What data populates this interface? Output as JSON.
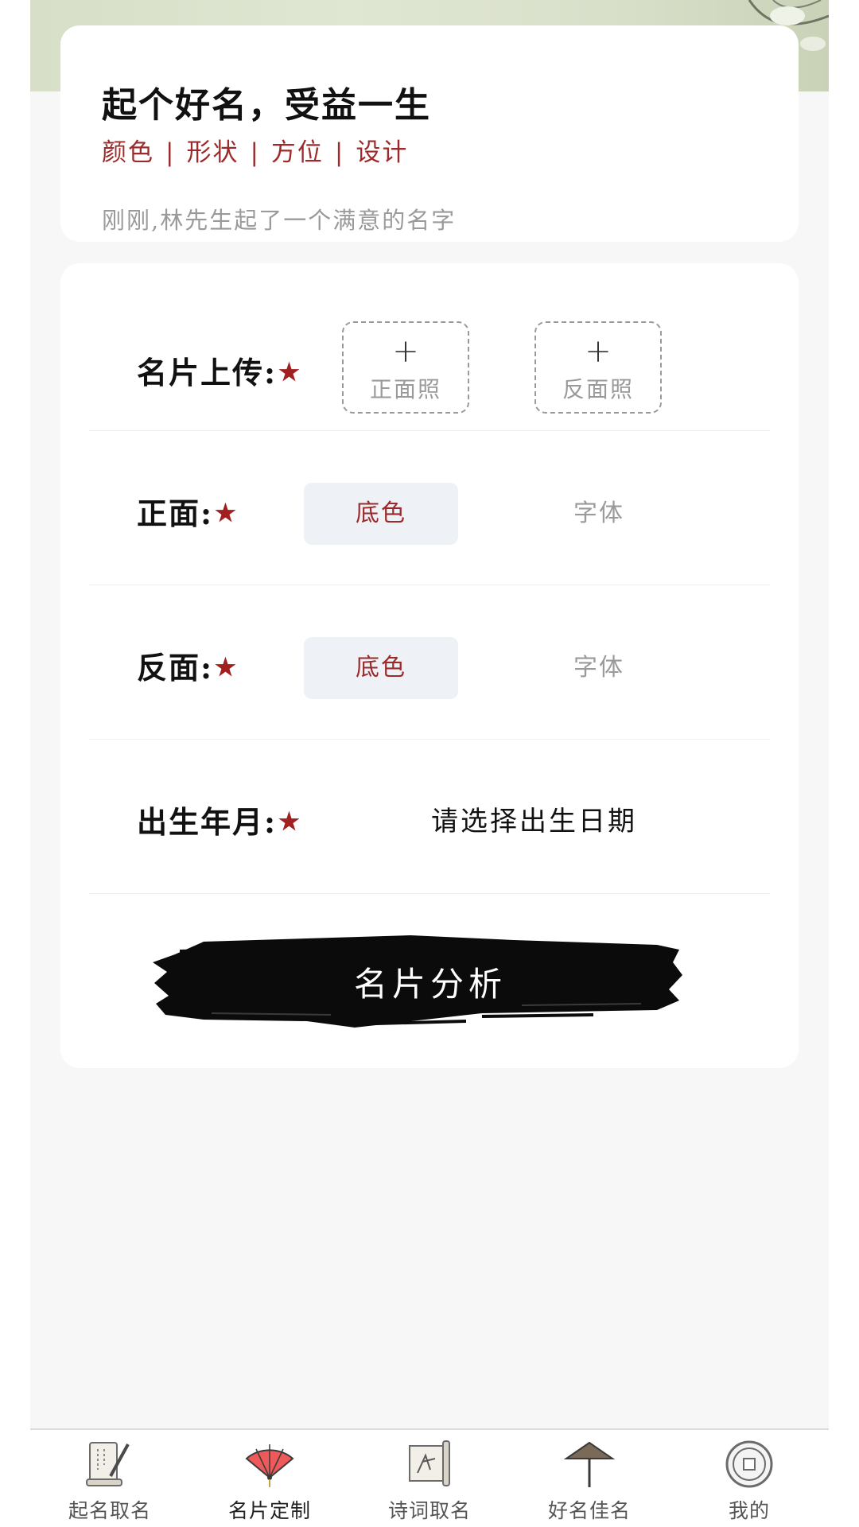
{
  "header": {
    "title": "起个好名，受益一生",
    "tags": [
      "颜色",
      "形状",
      "方位",
      "设计"
    ],
    "tag_separator": "|",
    "notice": "刚刚,林先生起了一个满意的名字"
  },
  "form": {
    "upload": {
      "label": "名片上传:",
      "front_plus": "+",
      "front_caption": "正面照",
      "back_plus": "+",
      "back_caption": "反面照"
    },
    "front": {
      "label": "正面:",
      "option_color": "底色",
      "option_font": "字体",
      "selected": "底色"
    },
    "back": {
      "label": "反面:",
      "option_color": "底色",
      "option_font": "字体",
      "selected": "底色"
    },
    "birth": {
      "label": "出生年月:",
      "placeholder": "请选择出生日期"
    },
    "required_mark": "★",
    "submit_label": "名片分析"
  },
  "tabbar": {
    "active_index": 1,
    "items": [
      {
        "label": "起名取名",
        "icon": "scroll-brush-icon"
      },
      {
        "label": "名片定制",
        "icon": "folding-fan-icon"
      },
      {
        "label": "诗词取名",
        "icon": "poem-scroll-icon"
      },
      {
        "label": "好名佳名",
        "icon": "paper-umbrella-icon"
      },
      {
        "label": "我的",
        "icon": "ancient-coin-icon"
      }
    ]
  },
  "colors": {
    "accent_red": "#9b2b2b",
    "star_red": "#a01f1f",
    "page_bg": "#f7f7f7",
    "segment_bg": "#eef1f5"
  }
}
